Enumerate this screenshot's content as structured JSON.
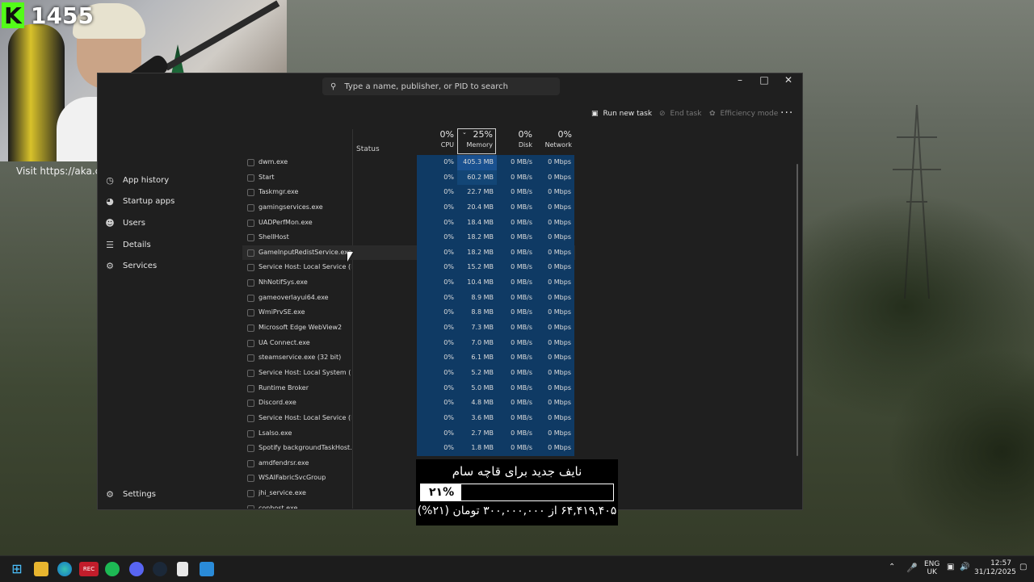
{
  "webcam": {
    "counter": "1455",
    "visit_text": "Visit https://aka.cfx"
  },
  "search": {
    "placeholder": "Type a name, publisher, or PID to search"
  },
  "toolbar": {
    "run_new_task": "Run new task",
    "end_task": "End task",
    "efficiency_mode": "Efficiency mode"
  },
  "nav": {
    "items": [
      {
        "label": "App history",
        "icon": "clock-icon"
      },
      {
        "label": "Startup apps",
        "icon": "speedometer-icon"
      },
      {
        "label": "Users",
        "icon": "users-icon"
      },
      {
        "label": "Details",
        "icon": "list-icon"
      },
      {
        "label": "Services",
        "icon": "gear-icon"
      }
    ],
    "settings_label": "Settings"
  },
  "columns": {
    "status": "Status",
    "cpu": {
      "pct": "0%",
      "label": "CPU"
    },
    "memory": {
      "pct": "25%",
      "label": "Memory"
    },
    "disk": {
      "pct": "0%",
      "label": "Disk"
    },
    "network": {
      "pct": "0%",
      "label": "Network"
    }
  },
  "processes": [
    {
      "name": "dwm.exe",
      "cpu": "0%",
      "mem": "405.3 MB",
      "disk": "0 MB/s",
      "net": "0 Mbps"
    },
    {
      "name": "Start",
      "cpu": "0%",
      "mem": "60.2 MB",
      "disk": "0 MB/s",
      "net": "0 Mbps"
    },
    {
      "name": "Taskmgr.exe",
      "cpu": "0%",
      "mem": "22.7 MB",
      "disk": "0 MB/s",
      "net": "0 Mbps"
    },
    {
      "name": "gamingservices.exe",
      "cpu": "0%",
      "mem": "20.4 MB",
      "disk": "0 MB/s",
      "net": "0 Mbps"
    },
    {
      "name": "UADPerfMon.exe",
      "cpu": "0%",
      "mem": "18.4 MB",
      "disk": "0 MB/s",
      "net": "0 Mbps"
    },
    {
      "name": "ShellHost",
      "cpu": "0%",
      "mem": "18.2 MB",
      "disk": "0 MB/s",
      "net": "0 Mbps"
    },
    {
      "name": "GameInputRedistService.exe",
      "cpu": "0%",
      "mem": "18.2 MB",
      "disk": "0 MB/s",
      "net": "0 Mbps"
    },
    {
      "name": "Service Host: Local Service (N...",
      "cpu": "0%",
      "mem": "15.2 MB",
      "disk": "0 MB/s",
      "net": "0 Mbps"
    },
    {
      "name": "NhNotifSys.exe",
      "cpu": "0%",
      "mem": "10.4 MB",
      "disk": "0 MB/s",
      "net": "0 Mbps"
    },
    {
      "name": "gameoverlayui64.exe",
      "cpu": "0%",
      "mem": "8.9 MB",
      "disk": "0 MB/s",
      "net": "0 Mbps"
    },
    {
      "name": "WmiPrvSE.exe",
      "cpu": "0%",
      "mem": "8.8 MB",
      "disk": "0 MB/s",
      "net": "0 Mbps"
    },
    {
      "name": "Microsoft Edge WebView2",
      "cpu": "0%",
      "mem": "7.3 MB",
      "disk": "0 MB/s",
      "net": "0 Mbps"
    },
    {
      "name": "UA Connect.exe",
      "cpu": "0%",
      "mem": "7.0 MB",
      "disk": "0 MB/s",
      "net": "0 Mbps"
    },
    {
      "name": "steamservice.exe (32 bit)",
      "cpu": "0%",
      "mem": "6.1 MB",
      "disk": "0 MB/s",
      "net": "0 Mbps"
    },
    {
      "name": "Service Host: Local System (N...",
      "cpu": "0%",
      "mem": "5.2 MB",
      "disk": "0 MB/s",
      "net": "0 Mbps"
    },
    {
      "name": "Runtime Broker",
      "cpu": "0%",
      "mem": "5.0 MB",
      "disk": "0 MB/s",
      "net": "0 Mbps"
    },
    {
      "name": "Discord.exe",
      "cpu": "0%",
      "mem": "4.8 MB",
      "disk": "0 MB/s",
      "net": "0 Mbps"
    },
    {
      "name": "Service Host: Local Service (N...",
      "cpu": "0%",
      "mem": "3.6 MB",
      "disk": "0 MB/s",
      "net": "0 Mbps"
    },
    {
      "name": "Lsalso.exe",
      "cpu": "0%",
      "mem": "2.7 MB",
      "disk": "0 MB/s",
      "net": "0 Mbps"
    },
    {
      "name": "Spotify backgroundTaskHost....",
      "cpu": "0%",
      "mem": "1.8 MB",
      "disk": "0 MB/s",
      "net": "0 Mbps"
    },
    {
      "name": "amdfendrsr.exe",
      "cpu": "",
      "mem": "",
      "disk": "",
      "net": ""
    },
    {
      "name": "WSAIFabricSvcGroup",
      "cpu": "",
      "mem": "",
      "disk": "",
      "net": ""
    },
    {
      "name": "jhi_service.exe",
      "cpu": "",
      "mem": "",
      "disk": "",
      "net": ""
    },
    {
      "name": "conhost.exe",
      "cpu": "",
      "mem": "",
      "disk": "",
      "net": ""
    }
  ],
  "donation": {
    "title": "نایف جدید برای قاچه سام",
    "percent_label": "۲۱%",
    "progress": 0.21,
    "summary": "۶۴,۴۱۹,۴۰۵ از ۳۰۰,۰۰۰,۰۰۰ تومان (۲۱%)"
  },
  "taskbar": {
    "icons": [
      "windows-start-icon",
      "file-explorer-icon",
      "edge-icon",
      "streaming-app-icon",
      "spotify-icon",
      "discord-icon",
      "steam-icon",
      "notepad-icon",
      "photos-icon"
    ],
    "lang_top": "ENG",
    "lang_bottom": "UK",
    "time": "12:57",
    "date": "31/12/2025"
  },
  "colors": {
    "accent_cell": "#0f3a64",
    "kick_green": "#53fc18"
  }
}
